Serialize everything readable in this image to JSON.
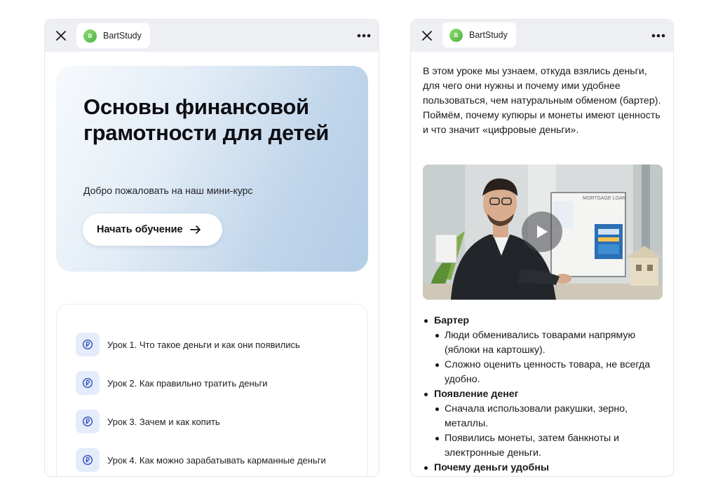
{
  "left_screen": {
    "app_name": "BartStudy",
    "app_logo_letter": "B",
    "hero": {
      "title": "Основы финансовой грамотности для детей",
      "subtitle": "Добро пожаловать на наш мини-курс",
      "button_label": "Начать обучение"
    },
    "lessons": [
      {
        "label": "Урок 1. Что такое деньги и как они появились",
        "icon": "ruble-coin-icon"
      },
      {
        "label": "Урок 2. Как правильно тратить деньги",
        "icon": "ruble-coin-icon"
      },
      {
        "label": "Урок 3. Зачем и как копить",
        "icon": "ruble-coin-icon"
      },
      {
        "label": "Урок 4. Как можно зарабатывать карманные деньги",
        "icon": "ruble-coin-icon"
      }
    ]
  },
  "right_screen": {
    "app_name": "BartStudy",
    "app_logo_letter": "B",
    "intro": "В этом уроке мы узнаем, откуда взялись деньги, для чего они нужны и почему ими удобнее пользоваться, чем натуральным обменом (бартер). Поймём, почему купюры и монеты имеют ценность и что значит «цифровые деньги».",
    "video": {
      "poster_board_text": "MORTGAGE LOAN"
    },
    "sections": [
      {
        "heading": "Бартер",
        "items": [
          "Люди обменивались товарами напрямую (яблоки на картошку).",
          "Сложно оценить ценность товара, не всегда удобно."
        ]
      },
      {
        "heading": "Появление денег",
        "items": [
          "Сначала использовали ракушки, зерно, металлы.",
          "Появились монеты, затем банкноты и электронные деньги."
        ]
      },
      {
        "heading": "Почему деньги удобны",
        "items": []
      }
    ]
  },
  "colors": {
    "topbar": "#eeeff3",
    "hero_gradient_end": "#b3cde6",
    "lesson_icon_bg": "#e4ebfa",
    "lesson_icon": "#2f4fb8",
    "logo_green": "#5cbf4e"
  }
}
